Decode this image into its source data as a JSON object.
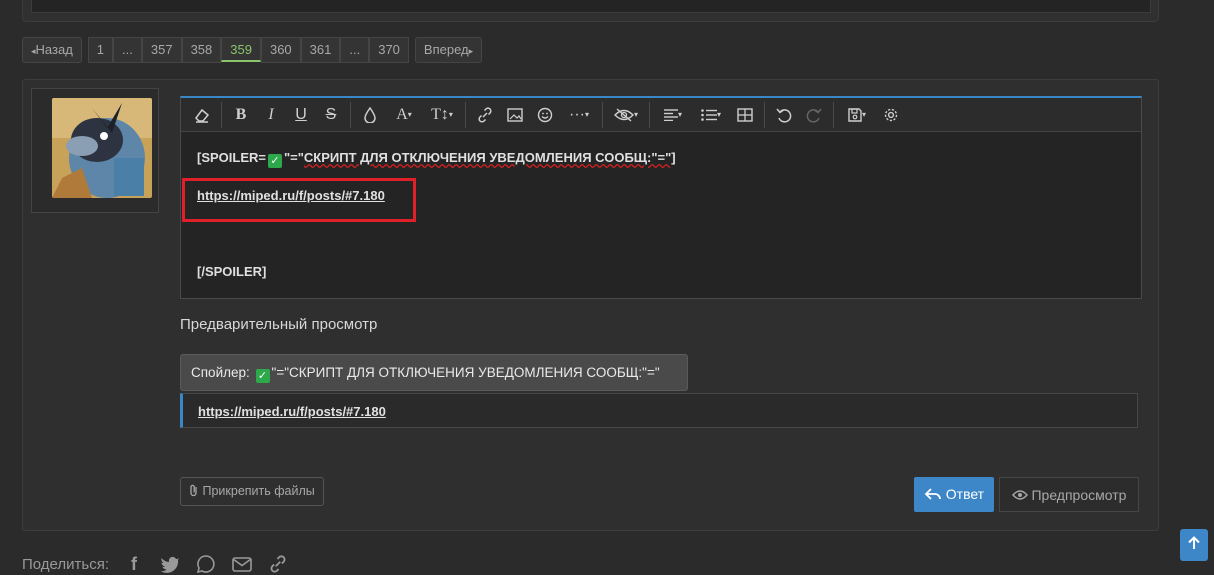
{
  "pagination": {
    "prev": "Назад",
    "next": "Вперед",
    "pages": [
      "1",
      "...",
      "357",
      "358",
      "359",
      "360",
      "361",
      "...",
      "370"
    ],
    "current": "359"
  },
  "editor": {
    "line1_prefix": "[SPOILER=",
    "line1_mid": "\"=\"",
    "line1_caps": "СКРИПТ ДЛЯ ОТКЛЮЧЕНИЯ УВЕДОМЛЕНИЯ СООБЩ:\"=\"]",
    "link": "https://miped.ru/f/posts/#7.180",
    "closing": "[/SPOILER]",
    "toolbar_icons": [
      "eraser-icon",
      "bold-icon",
      "italic-icon",
      "underline-icon",
      "strikethrough-icon",
      "color-icon",
      "font-family-icon",
      "font-size-icon",
      "link-icon",
      "image-icon",
      "smile-icon",
      "more-icon",
      "hide-icon",
      "align-icon",
      "list-icon",
      "table-icon",
      "undo-icon",
      "redo-icon",
      "drafts-icon",
      "settings-icon"
    ]
  },
  "preview": {
    "title": "Предварительный просмотр",
    "spoiler_label": "Спойлер:",
    "spoiler_text": "\"=\"СКРИПТ ДЛЯ ОТКЛЮЧЕНИЯ УВЕДОМЛЕНИЯ СООБЩ:\"=\"",
    "link": "https://miped.ru/f/posts/#7.180"
  },
  "actions": {
    "attach": "Прикрепить файлы",
    "reply": "Ответ",
    "preview": "Предпросмотр"
  },
  "share": {
    "label": "Поделиться:",
    "icons": [
      "facebook-icon",
      "twitter-icon",
      "whatsapp-icon",
      "email-icon",
      "link-icon"
    ]
  },
  "colors": {
    "accent": "#3d87c8",
    "current_page": "#8ac46c",
    "highlight": "#e0202a",
    "check": "#2da84a"
  }
}
